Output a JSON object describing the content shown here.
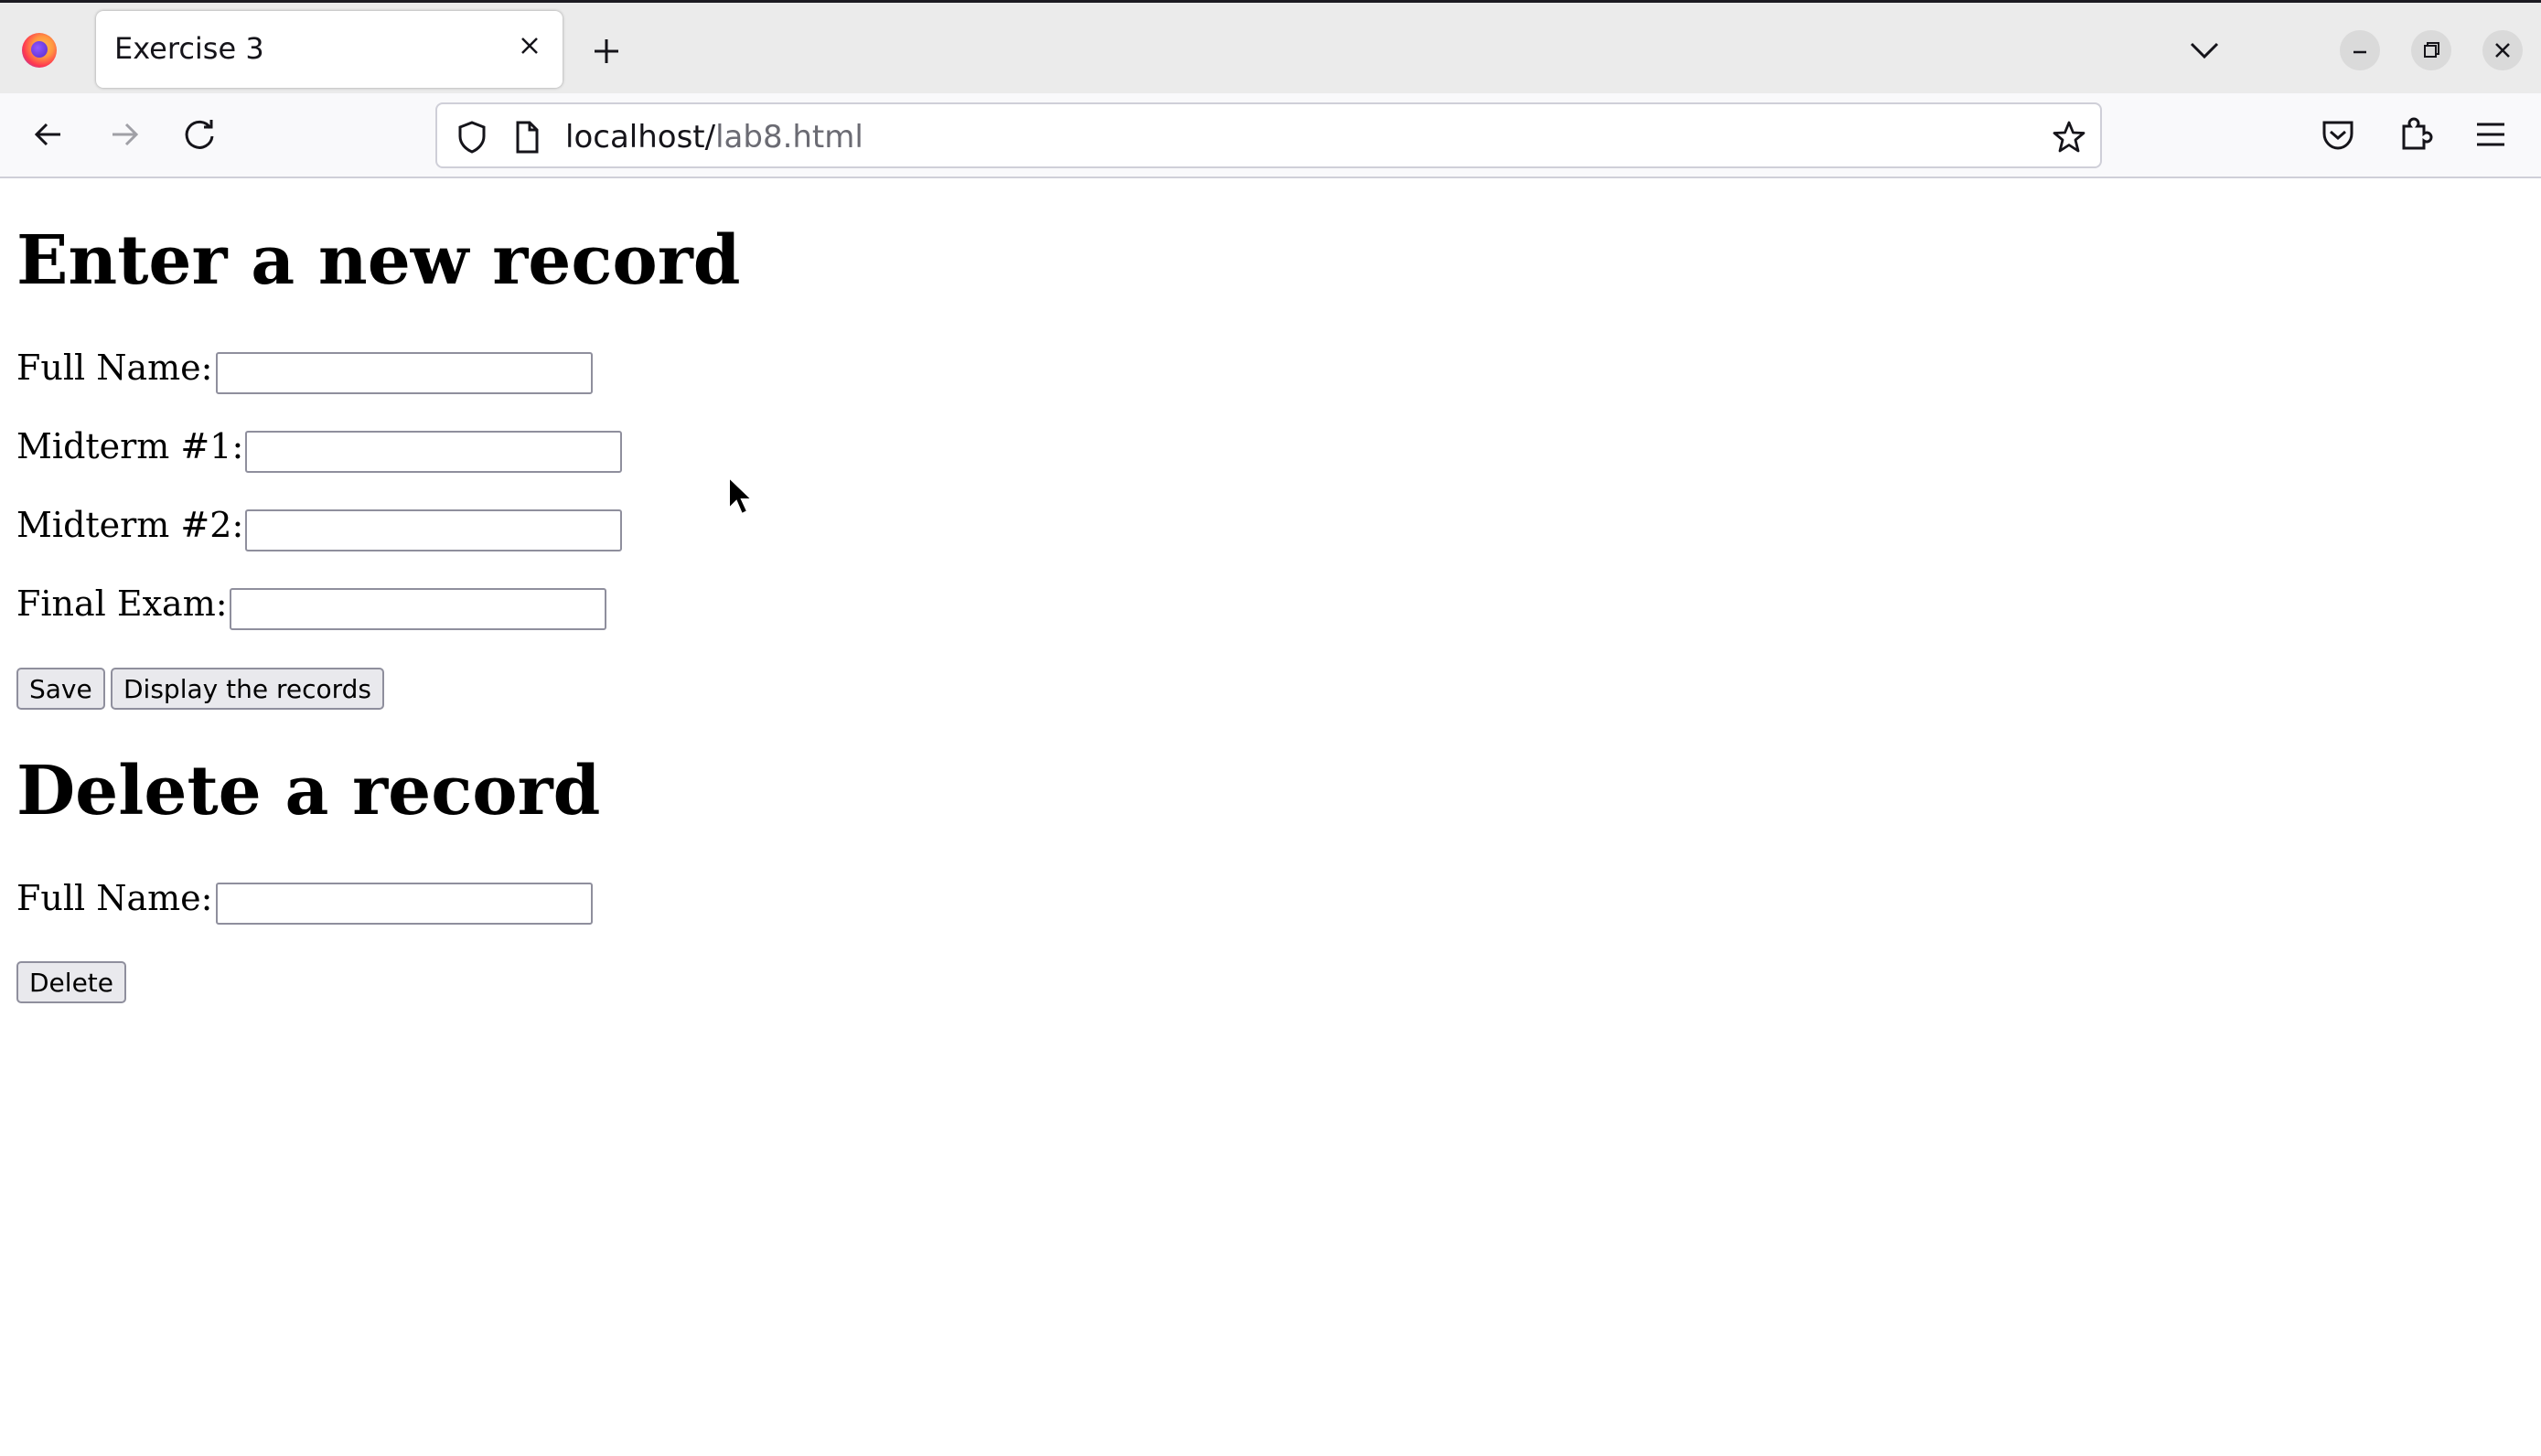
{
  "browser": {
    "tab_title": "Exercise 3",
    "url_host": "localhost/",
    "url_path": "lab8.html"
  },
  "page": {
    "add_heading": "Enter a new record",
    "full_name_label": "Full Name:",
    "midterm1_label": "Midterm #1:",
    "midterm2_label": "Midterm #2:",
    "final_label": "Final Exam:",
    "save_label": "Save",
    "display_label": "Display the records",
    "delete_heading": "Delete a record",
    "delete_name_label": "Full Name:",
    "delete_label": "Delete",
    "full_name_value": "",
    "midterm1_value": "",
    "midterm2_value": "",
    "final_value": "",
    "delete_name_value": ""
  },
  "colors": {
    "chrome_bg": "#ebebeb",
    "toolbar_bg": "#f9f9fb",
    "button_bg": "#e9e9ed"
  }
}
